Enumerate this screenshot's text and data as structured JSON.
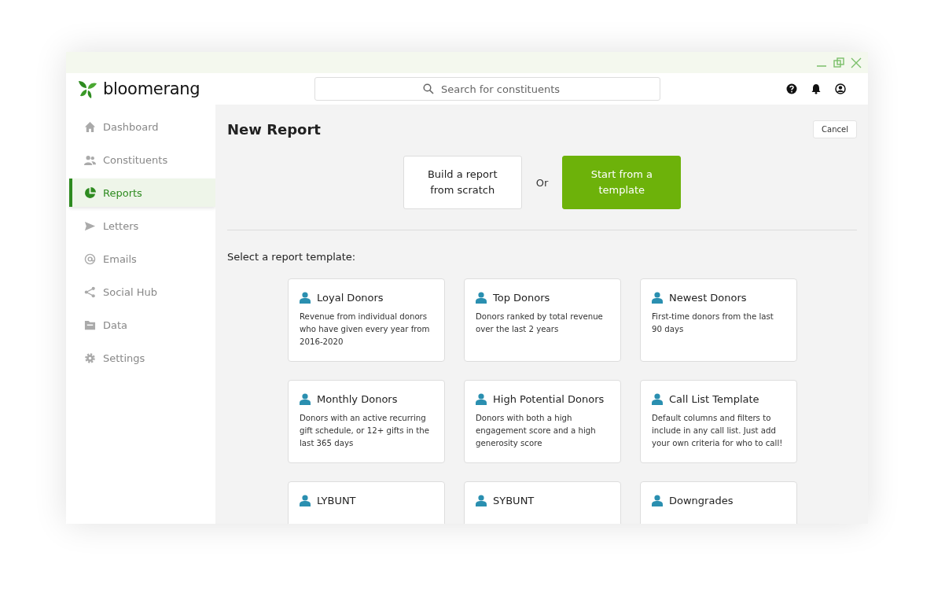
{
  "app": {
    "logo_text": "bloomerang"
  },
  "search": {
    "placeholder": "Search for constituents"
  },
  "sidebar": {
    "items": [
      {
        "label": "Dashboard",
        "kind": "home",
        "selected": false
      },
      {
        "label": "Constituents",
        "kind": "people",
        "selected": false
      },
      {
        "label": "Reports",
        "kind": "pie",
        "selected": true
      },
      {
        "label": "Letters",
        "kind": "send",
        "selected": false
      },
      {
        "label": "Emails",
        "kind": "at",
        "selected": false
      },
      {
        "label": "Social Hub",
        "kind": "share",
        "selected": false
      },
      {
        "label": "Data",
        "kind": "folder",
        "selected": false
      },
      {
        "label": "Settings",
        "kind": "gear",
        "selected": false
      }
    ]
  },
  "page": {
    "title": "New Report",
    "cancel": "Cancel",
    "modes": [
      {
        "label": "Build a report from scratch",
        "selected": false
      },
      {
        "label": "Start from a template",
        "selected": true
      }
    ],
    "or": "Or",
    "prompt": "Select a report template:",
    "templates": [
      {
        "title": "Loyal Donors",
        "description": "Revenue from individual donors who have given every year from 2016-2020"
      },
      {
        "title": "Top Donors",
        "description": "Donors ranked by total revenue over the last 2 years"
      },
      {
        "title": "Newest Donors",
        "description": "First-time donors from the last 90 days"
      },
      {
        "title": "Monthly Donors",
        "description": "Donors with an active recurring gift schedule, or 12+ gifts in the last 365 days"
      },
      {
        "title": "High Potential Donors",
        "description": "Donors with both a high engagement score and a high generosity score"
      },
      {
        "title": "Call List Template",
        "description": "Default columns and filters to include in any call list. Just add your own criteria for who to call!"
      },
      {
        "title": "LYBUNT"
      },
      {
        "title": "SYBUNT"
      },
      {
        "title": "Downgrades"
      }
    ]
  }
}
